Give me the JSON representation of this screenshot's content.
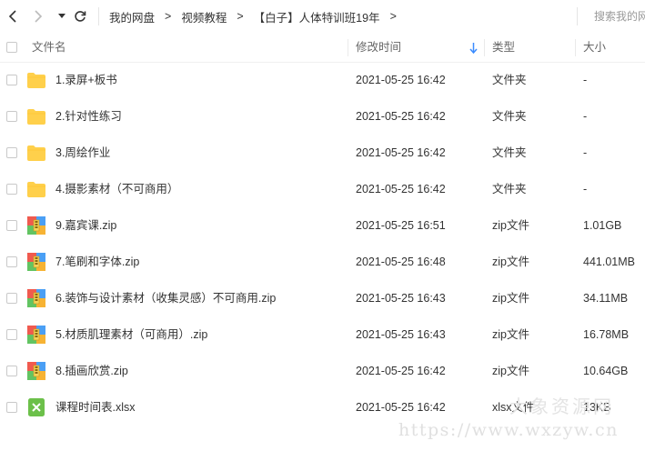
{
  "toolbar": {
    "breadcrumbs": [
      "我的网盘",
      "视频教程",
      "【白子】人体特训班19年"
    ],
    "separator": ">",
    "search_placeholder": "搜索我的网盘"
  },
  "table": {
    "headers": {
      "name": "文件名",
      "modified": "修改时间",
      "type": "类型",
      "size": "大小"
    },
    "rows": [
      {
        "icon": "folder-icon",
        "name": "1.录屏+板书",
        "modified": "2021-05-25 16:42",
        "type": "文件夹",
        "size": "-"
      },
      {
        "icon": "folder-icon",
        "name": "2.针对性练习",
        "modified": "2021-05-25 16:42",
        "type": "文件夹",
        "size": "-"
      },
      {
        "icon": "folder-icon",
        "name": "3.周绘作业",
        "modified": "2021-05-25 16:42",
        "type": "文件夹",
        "size": "-"
      },
      {
        "icon": "folder-icon",
        "name": "4.摄影素材（不可商用）",
        "modified": "2021-05-25 16:42",
        "type": "文件夹",
        "size": "-"
      },
      {
        "icon": "zip-icon",
        "name": "9.嘉宾课.zip",
        "modified": "2021-05-25 16:51",
        "type": "zip文件",
        "size": "1.01GB"
      },
      {
        "icon": "zip-icon",
        "name": "7.笔刷和字体.zip",
        "modified": "2021-05-25 16:48",
        "type": "zip文件",
        "size": "441.01MB"
      },
      {
        "icon": "zip-icon",
        "name": "6.装饰与设计素材（收集灵感）不可商用.zip",
        "modified": "2021-05-25 16:43",
        "type": "zip文件",
        "size": "34.11MB"
      },
      {
        "icon": "zip-icon",
        "name": "5.材质肌理素材（可商用）.zip",
        "modified": "2021-05-25 16:43",
        "type": "zip文件",
        "size": "16.78MB"
      },
      {
        "icon": "zip-icon",
        "name": "8.插画欣赏.zip",
        "modified": "2021-05-25 16:42",
        "type": "zip文件",
        "size": "10.64GB"
      },
      {
        "icon": "xlsx-icon",
        "name": "课程时间表.xlsx",
        "modified": "2021-05-25 16:42",
        "type": "xlsx文件",
        "size": "13KB"
      }
    ]
  },
  "watermark": {
    "cn": "大象资源网",
    "url": "https://www.wxzyw.cn"
  },
  "colors": {
    "folder": "#FFD04B",
    "sort_arrow": "#3b8cff",
    "xlsx": "#6cc04a"
  }
}
